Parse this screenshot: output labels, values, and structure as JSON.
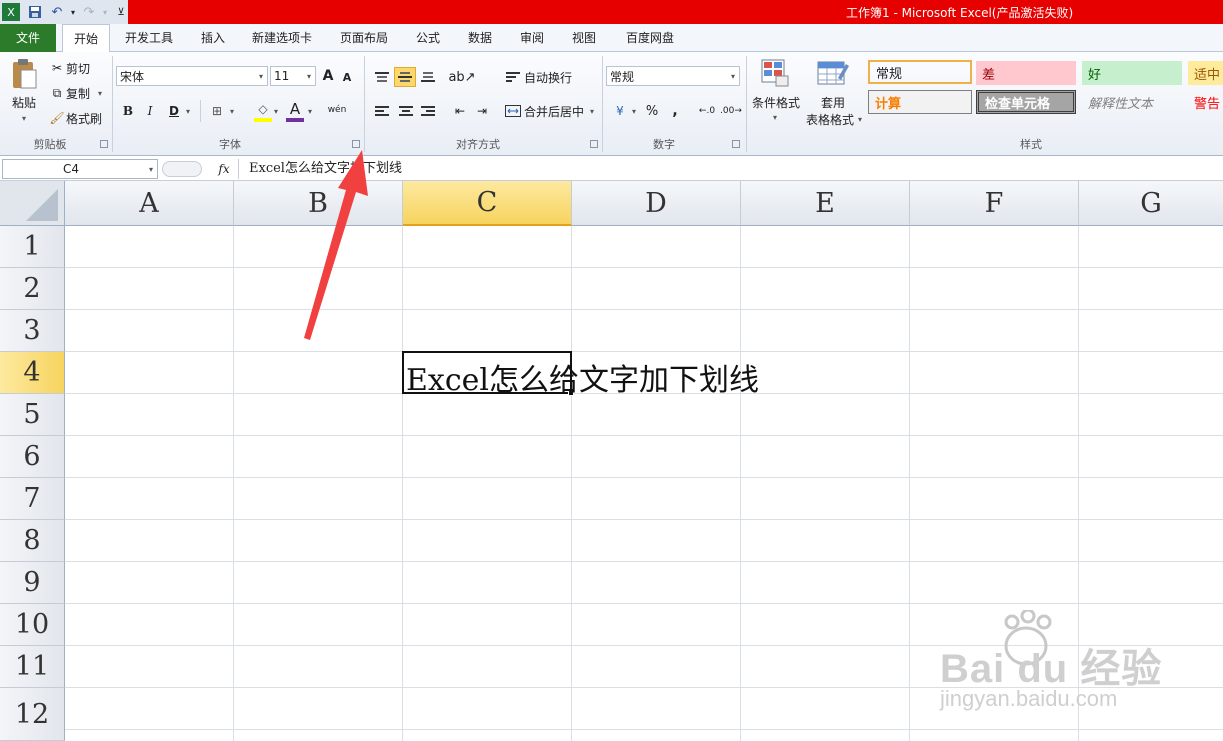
{
  "window": {
    "title": "工作簿1 - Microsoft Excel(产品激活失败)"
  },
  "tabs": [
    {
      "label": "文件"
    },
    {
      "label": "开始"
    },
    {
      "label": "开发工具"
    },
    {
      "label": "插入"
    },
    {
      "label": "新建选项卡"
    },
    {
      "label": "页面布局"
    },
    {
      "label": "公式"
    },
    {
      "label": "数据"
    },
    {
      "label": "审阅"
    },
    {
      "label": "视图"
    },
    {
      "label": "百度网盘"
    }
  ],
  "clipboard": {
    "paste": "粘贴",
    "cut": "剪切",
    "copy": "复制",
    "format_painter": "格式刷",
    "label": "剪贴板"
  },
  "font": {
    "name": "宋体",
    "size": "11",
    "bold": "B",
    "italic": "I",
    "underline": "D",
    "label": "字体",
    "grow": "A",
    "shrink": "A",
    "color_letter": "A"
  },
  "alignment": {
    "wrap": "自动换行",
    "merge": "合并后居中",
    "label": "对齐方式"
  },
  "number": {
    "format": "常规",
    "percent": "%",
    "comma": ",",
    "label": "数字"
  },
  "styles_group": {
    "conditional": "条件格式",
    "table_format_1": "套用",
    "table_format_2": "表格格式",
    "label": "样式",
    "cells": [
      {
        "text": "常规",
        "bg": "#ffffff",
        "color": "#000000"
      },
      {
        "text": "差",
        "bg": "#ffc7ce",
        "color": "#9c0006"
      },
      {
        "text": "好",
        "bg": "#c6efce",
        "color": "#006100"
      },
      {
        "text": "适中",
        "bg": "#ffeb9c",
        "color": "#9c5700"
      },
      {
        "text": "计算",
        "bg": "#f2f2f2",
        "color": "#fa7d00"
      },
      {
        "text": "检查单元格",
        "bg": "#a5a5a5",
        "color": "#ffffff"
      },
      {
        "text": "解释性文本",
        "bg": "#ffffff",
        "color": "#7f7f7f"
      },
      {
        "text": "警告",
        "bg": "#ffffff",
        "color": "#ff0000"
      }
    ]
  },
  "formula_bar": {
    "name_box": "C4",
    "fx": "fx",
    "content": "Excel怎么给文字加下划线"
  },
  "grid": {
    "columns": [
      "A",
      "B",
      "C",
      "D",
      "E",
      "F",
      "G"
    ],
    "rows": [
      "1",
      "2",
      "3",
      "4",
      "5",
      "6",
      "7",
      "8",
      "9",
      "10",
      "11",
      "12"
    ],
    "selected_column": "C",
    "selected_row": "4",
    "active_cell_text": "Excel怎么给文字加下划线"
  },
  "watermark": {
    "brand": "Bai du 经验",
    "url": "jingyan.baidu.com"
  },
  "colors": {
    "file_tab": "#2b7b2b",
    "title_bar": "#e60000",
    "arrow": "#f04040",
    "selection": "#f7d45e"
  }
}
